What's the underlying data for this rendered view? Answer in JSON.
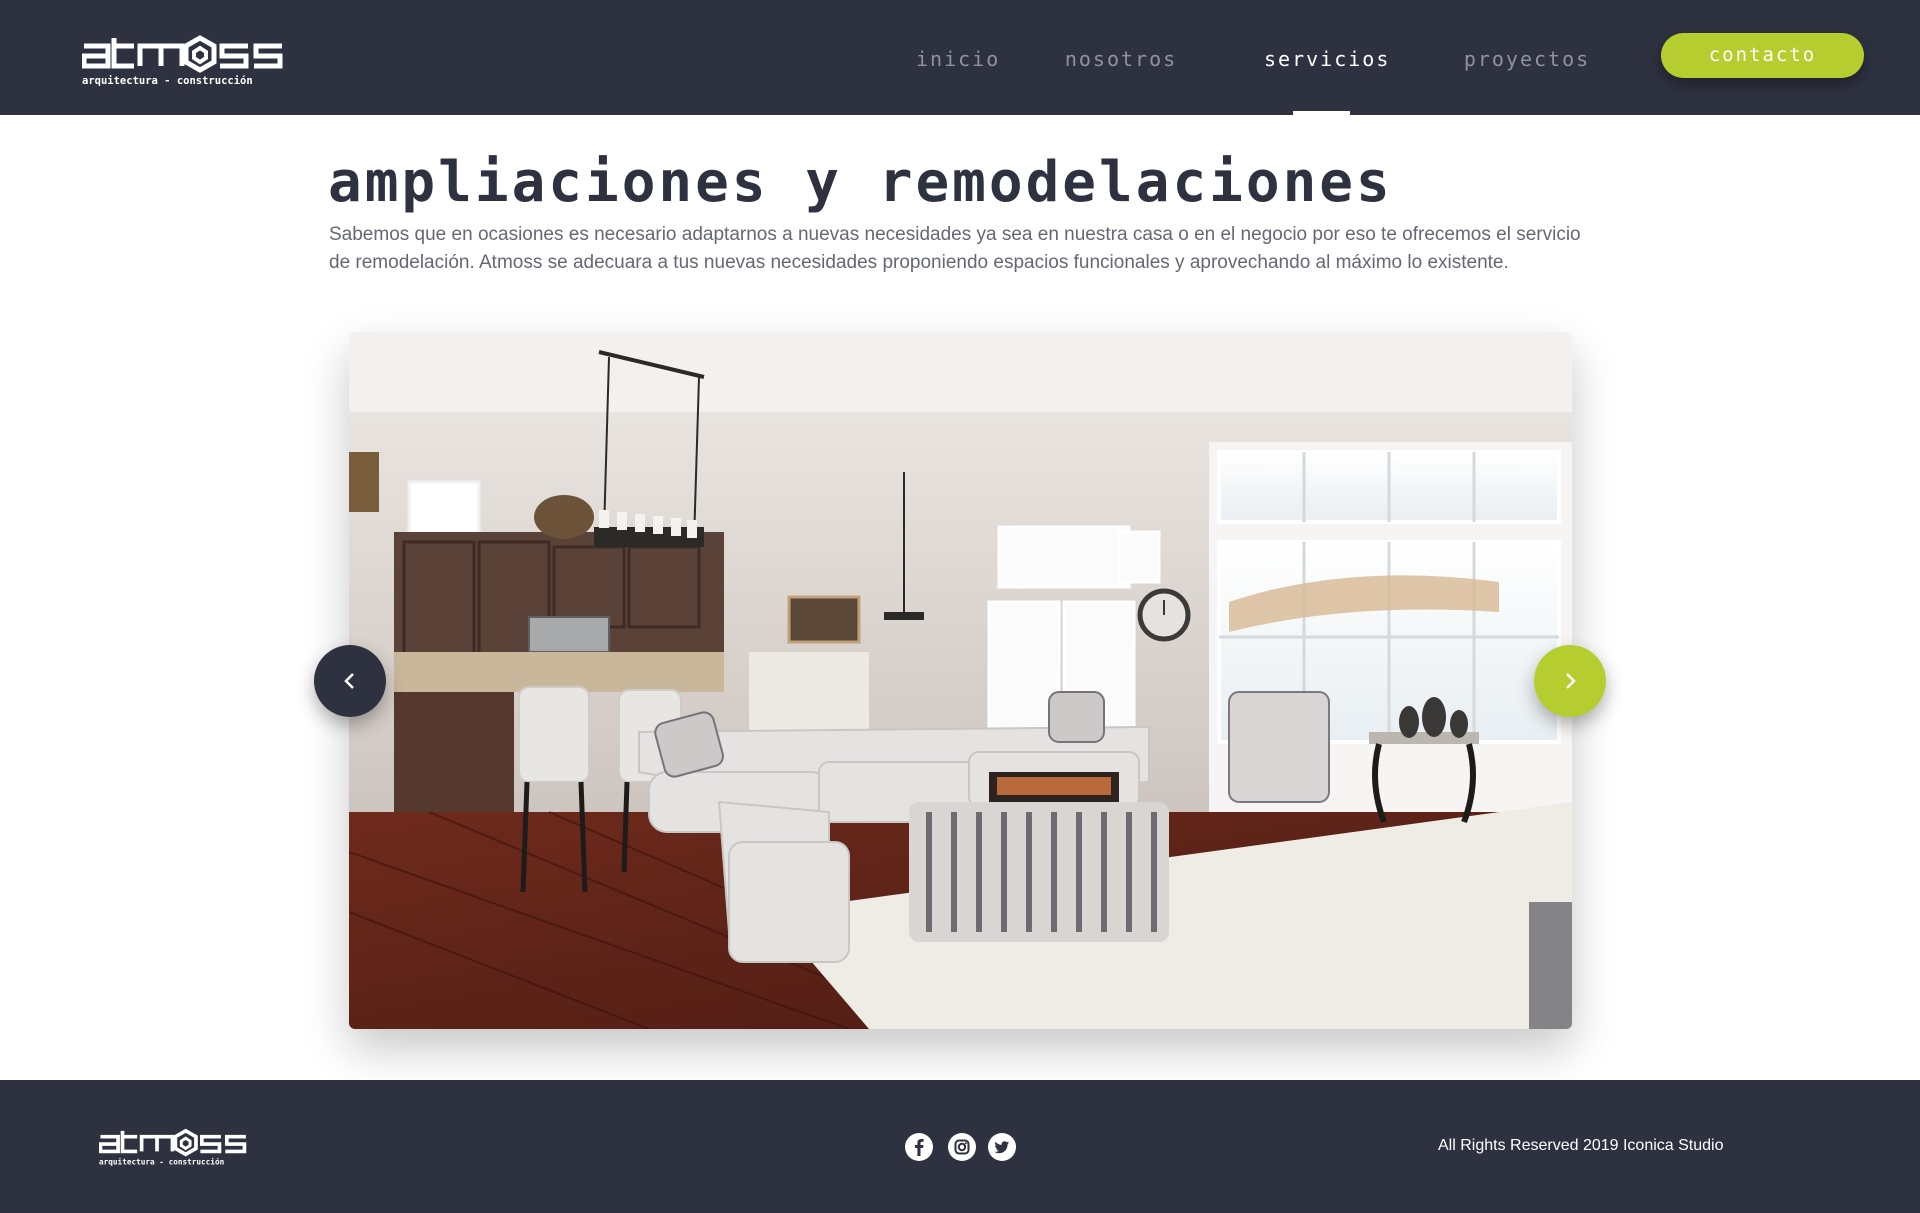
{
  "header": {
    "logo": {
      "name": "atmoss",
      "tagline": "arquitectura - construcción"
    },
    "nav": [
      {
        "label": "inicio",
        "active": false
      },
      {
        "label": "nosotros",
        "active": false
      },
      {
        "label": "servicios",
        "active": true
      },
      {
        "label": "proyectos",
        "active": false
      }
    ],
    "contact_label": "contacto"
  },
  "main": {
    "title": "ampliaciones y remodelaciones",
    "intro": "Sabemos que en ocasiones es necesario adaptarnos a nuevas necesidades ya sea en nuestra casa o en el negocio por eso te ofrecemos el servicio de remodelación. Atmoss se adecuara a tus nuevas necesidades proponiendo espacios funcionales y aprovechando al máximo lo existente.",
    "slider": {
      "prev_icon": "chevron-left-icon",
      "next_icon": "chevron-right-icon"
    }
  },
  "footer": {
    "social": [
      {
        "icon": "facebook-icon"
      },
      {
        "icon": "instagram-icon"
      },
      {
        "icon": "twitter-icon"
      }
    ],
    "copyright": "All Rights Reserved 2019 Iconica Studio"
  },
  "colors": {
    "dark": "#2e3140",
    "accent": "#b6cd2f",
    "text": "#646874",
    "nav_inactive": "#8f929c"
  }
}
